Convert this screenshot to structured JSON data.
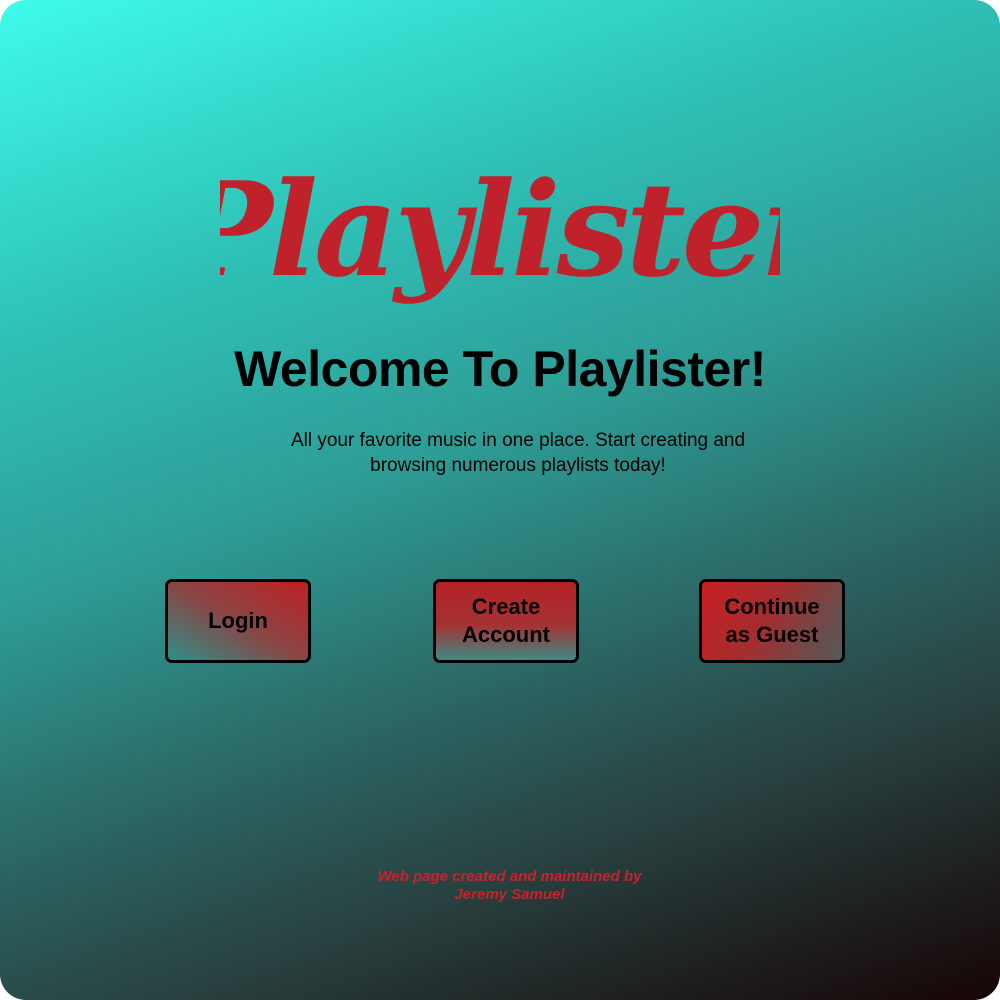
{
  "logo": {
    "text": "Playlister",
    "color": "#c0222b"
  },
  "headline": "Welcome To Playlister!",
  "tagline": "All your favorite music in one place. Start creating and browsing numerous playlists today!",
  "buttons": {
    "login": "Login",
    "create_line1": "Create",
    "create_line2": "Account",
    "guest_line1": "Continue",
    "guest_line2": "as Guest"
  },
  "footer": {
    "line1": "Web page created and maintained by",
    "line2": "Jeremy Samuel",
    "color": "#c6242a"
  }
}
